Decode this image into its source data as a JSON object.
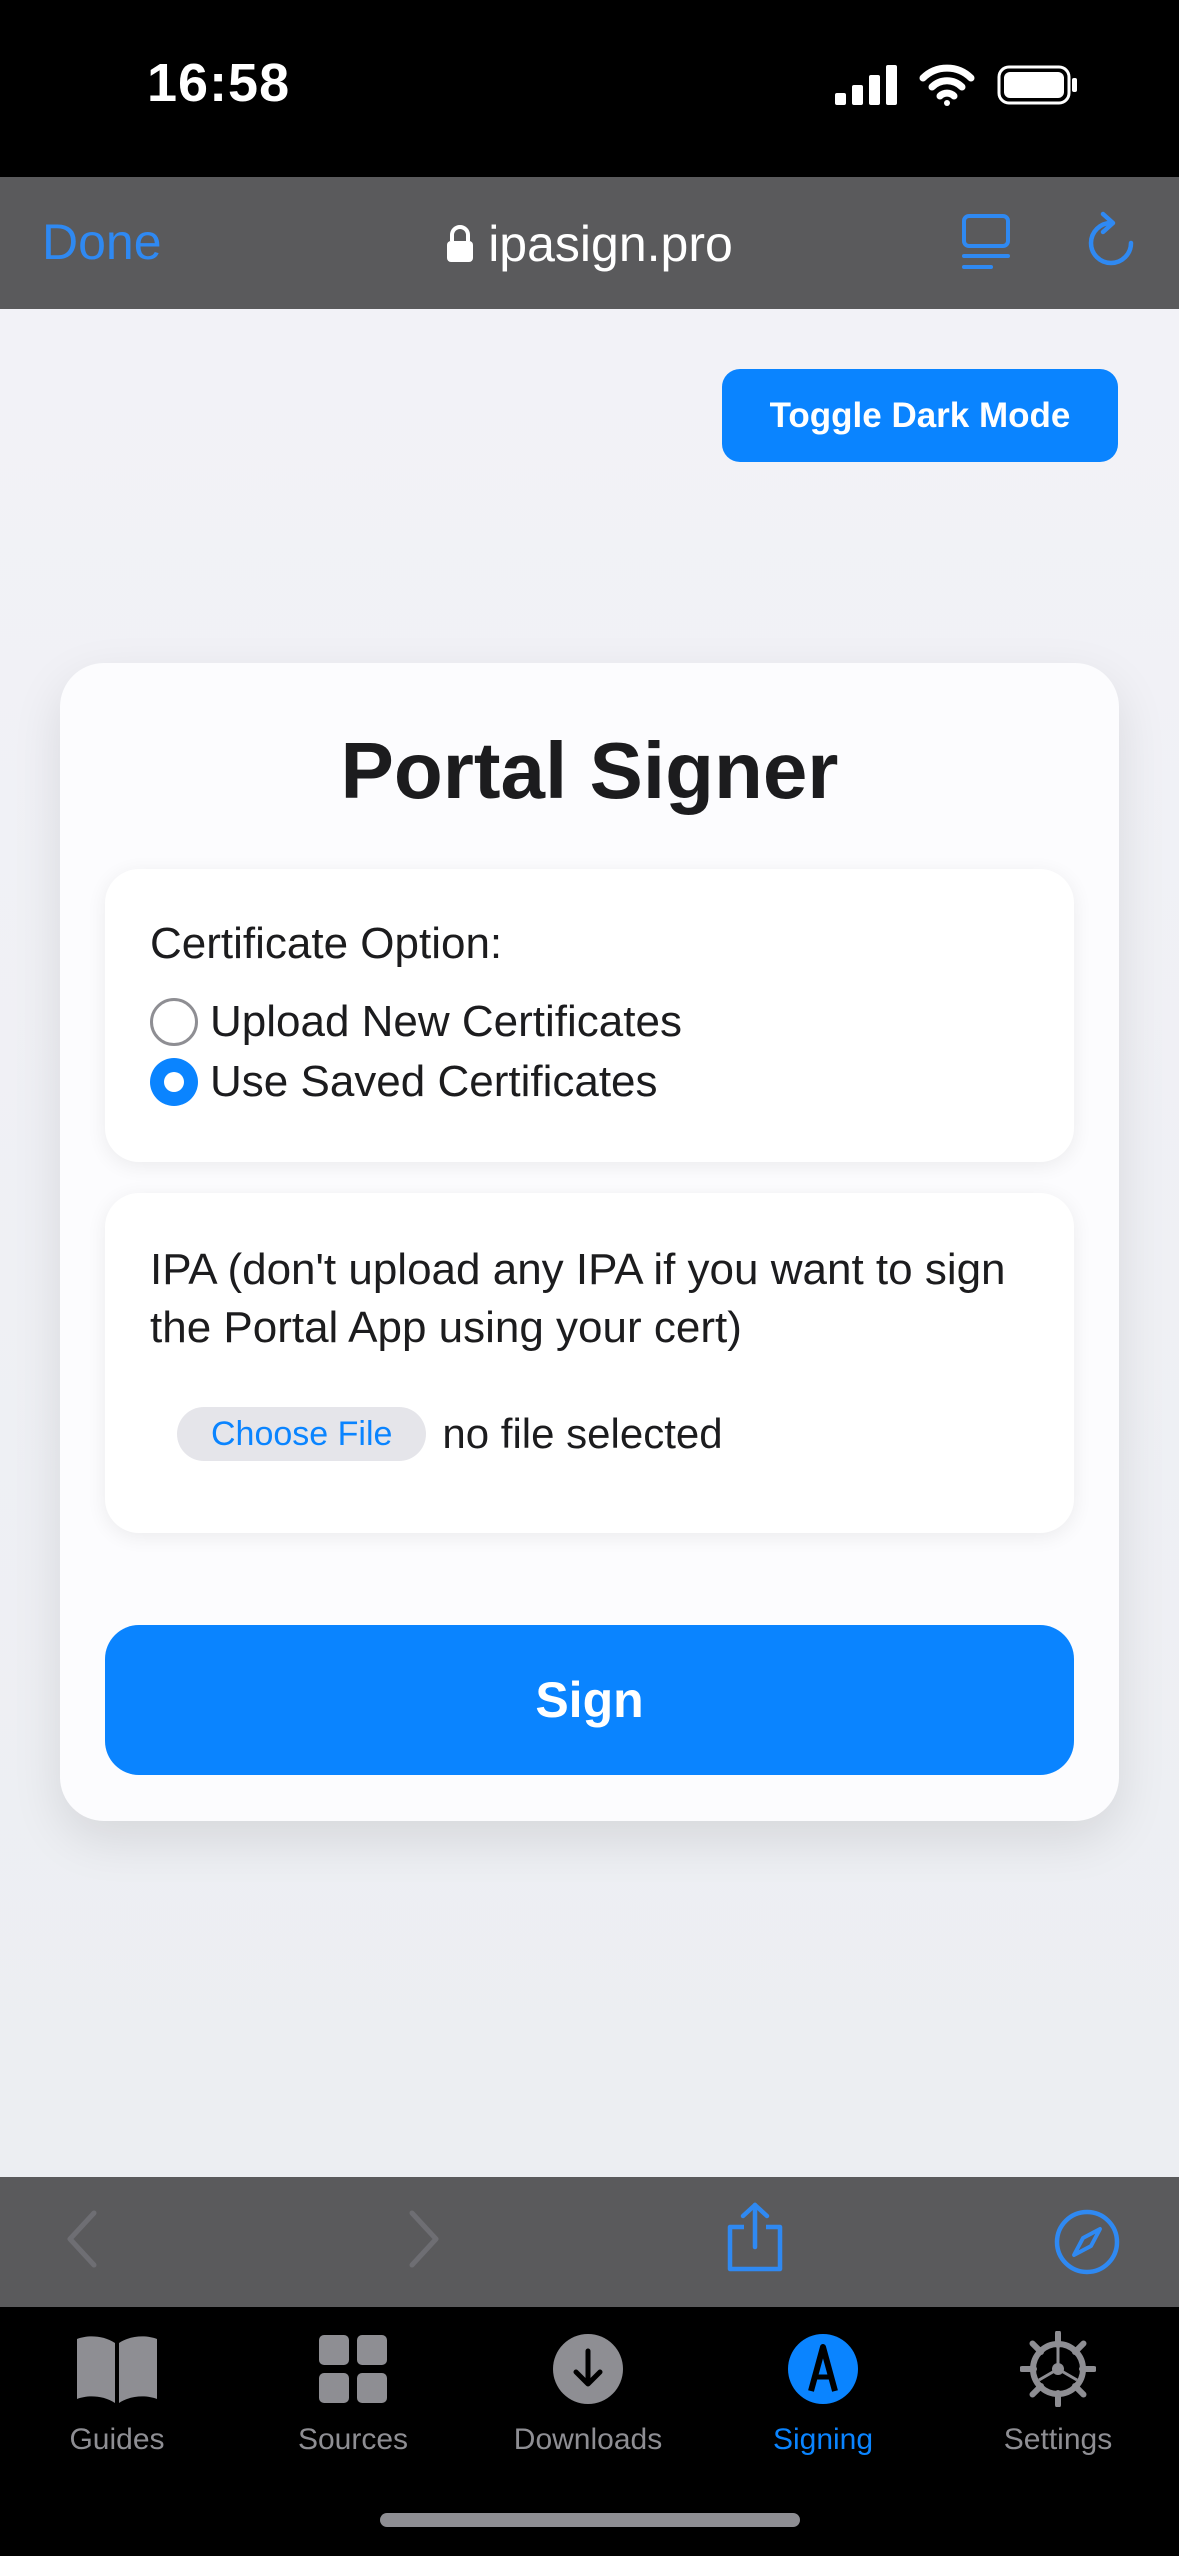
{
  "status_bar": {
    "time": "16:58"
  },
  "browser": {
    "done_label": "Done",
    "url": "ipasign.pro",
    "accent_color": "#2f89f2"
  },
  "page": {
    "dark_mode_label": "Toggle Dark Mode",
    "title": "Portal Signer",
    "certificate": {
      "label": "Certificate Option:",
      "options": [
        {
          "label": "Upload New Certificates",
          "selected": false
        },
        {
          "label": "Use Saved Certificates",
          "selected": true
        }
      ]
    },
    "ipa": {
      "label": "IPA (don't upload any IPA if you want to sign the Portal App using your cert)",
      "choose_file_label": "Choose File",
      "file_status": "no file selected"
    },
    "sign_label": "Sign",
    "primary_color": "#0a84ff"
  },
  "tab_bar": {
    "tabs": [
      {
        "label": "Guides",
        "icon": "book-icon",
        "active": false
      },
      {
        "label": "Sources",
        "icon": "grid-icon",
        "active": false
      },
      {
        "label": "Downloads",
        "icon": "download-icon",
        "active": false
      },
      {
        "label": "Signing",
        "icon": "signing-icon",
        "active": true
      },
      {
        "label": "Settings",
        "icon": "gear-icon",
        "active": false
      }
    ]
  }
}
